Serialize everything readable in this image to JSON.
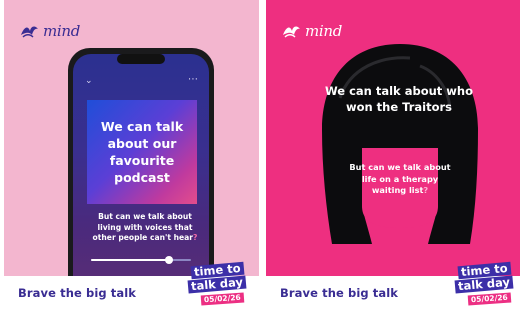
{
  "brand": {
    "logo_text": "mind"
  },
  "colors": {
    "left_background": "#f3b6cf",
    "right_background": "#ee2f80",
    "brand_purple": "#3a2d93",
    "badge_blue": "#3c2fa8",
    "badge_pink": "#ec2f83"
  },
  "left_poster": {
    "phone_screen": {
      "headline": "We can talk about our favourite podcast",
      "caption_main": "But can we talk about living with voices that other people can't hear",
      "caption_mark": "?",
      "progress": 0.78
    },
    "footer": "Brave the big talk",
    "badge": {
      "line1": "time to",
      "line2": "talk day",
      "date": "05/02/26"
    }
  },
  "right_poster": {
    "top_text": "We can talk about who won the Traitors",
    "bottom_text_main": "But can we talk about life on a therapy waiting list",
    "bottom_text_mark": "?",
    "footer": "Brave the big talk",
    "badge": {
      "line1": "time to",
      "line2": "talk day",
      "date": "05/02/26"
    }
  },
  "icons": [
    "mind-logo-icon",
    "chevron-down-icon",
    "more-dots-icon"
  ]
}
